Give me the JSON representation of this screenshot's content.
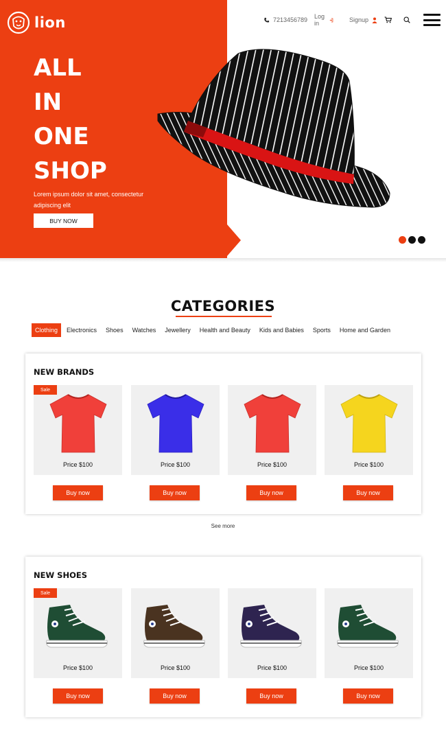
{
  "brand": {
    "name": "lion",
    "logo_icon": "lion-head-icon"
  },
  "topbar": {
    "phone": "7213456789",
    "login": "Log in",
    "signup": "Signup",
    "icons": [
      "phone-icon",
      "login-icon",
      "user-icon",
      "cart-icon",
      "search-icon",
      "menu-icon"
    ]
  },
  "hero": {
    "headline": [
      "ALL",
      "IN",
      "ONE",
      "SHOP"
    ],
    "description": "Lorem ipsum dolor sit amet, consectetur adipiscing elit",
    "button": "BUY NOW",
    "slides": 3,
    "active_slide": 1,
    "accent": "#ec3f12"
  },
  "categories": {
    "title": "CATEGORIES",
    "tabs": [
      "Clothing",
      "Electronics",
      "Shoes",
      "Watches",
      "Jewellery",
      "Health and Beauty",
      "Kids and Babies",
      "Sports",
      "Home and Garden"
    ],
    "active_tab": "Clothing"
  },
  "sections": [
    {
      "title": "NEW BRANDS",
      "products": [
        {
          "type": "tshirt",
          "color": "#f0403a",
          "price": "Price $100",
          "sale": "Sale",
          "button": "Buy now"
        },
        {
          "type": "tshirt",
          "color": "#3a2ee8",
          "price": "Price $100",
          "button": "Buy now"
        },
        {
          "type": "tshirt",
          "color": "#f0403a",
          "price": "Price $100",
          "button": "Buy now"
        },
        {
          "type": "tshirt",
          "color": "#f5d51e",
          "price": "Price $100",
          "button": "Buy now"
        }
      ]
    },
    {
      "title": "NEW SHOES",
      "products": [
        {
          "type": "sneaker",
          "color": "#1f4d34",
          "price": "Price $100",
          "sale": "Sale",
          "button": "Buy now"
        },
        {
          "type": "sneaker",
          "color": "#4a3320",
          "price": "Price $100",
          "button": "Buy now"
        },
        {
          "type": "sneaker",
          "color": "#2e2450",
          "price": "Price $100",
          "button": "Buy now"
        },
        {
          "type": "sneaker",
          "color": "#1f4d34",
          "price": "Price $100",
          "button": "Buy now"
        }
      ]
    }
  ],
  "see_more": "See more"
}
